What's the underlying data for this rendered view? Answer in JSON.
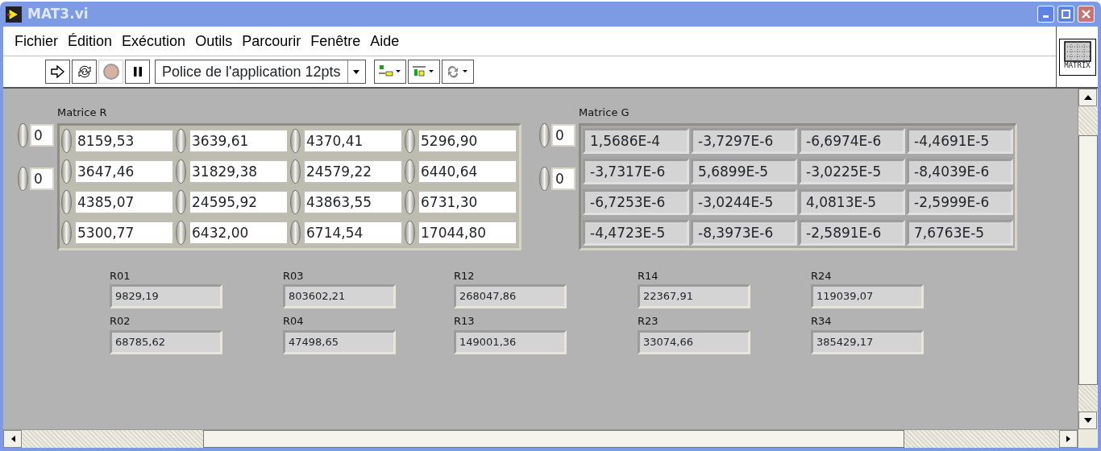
{
  "window": {
    "title": "MAT3.vi"
  },
  "menu": [
    {
      "label": "Fichier"
    },
    {
      "label": "Édition"
    },
    {
      "label": "Exécution"
    },
    {
      "label": "Outils"
    },
    {
      "label": "Parcourir"
    },
    {
      "label": "Fenêtre"
    },
    {
      "label": "Aide"
    }
  ],
  "toolbar": {
    "font_selector": "Police de l'application 12pts"
  },
  "vi_icon": {
    "label": "MATRIX"
  },
  "matrices": [
    {
      "label": "Matrice R",
      "kind": "control",
      "indices": [
        "0",
        "0"
      ],
      "rows": [
        [
          "8159,53",
          "3639,61",
          "4370,41",
          "5296,90"
        ],
        [
          "3647,46",
          "31829,38",
          "24579,22",
          "6440,64"
        ],
        [
          "4385,07",
          "24595,92",
          "43863,55",
          "6731,30"
        ],
        [
          "5300,77",
          "6432,00",
          "6714,54",
          "17044,80"
        ]
      ]
    },
    {
      "label": "Matrice G",
      "kind": "indicator",
      "indices": [
        "0",
        "0"
      ],
      "rows": [
        [
          "1,5686E-4",
          "-3,7297E-6",
          "-6,6974E-6",
          "-4,4691E-5"
        ],
        [
          "-3,7317E-6",
          "5,6899E-5",
          "-3,0225E-5",
          "-8,4039E-6"
        ],
        [
          "-6,7253E-6",
          "-3,0244E-5",
          "4,0813E-5",
          "-2,5999E-6"
        ],
        [
          "-4,4723E-5",
          "-8,3973E-6",
          "-2,5891E-6",
          "7,6763E-5"
        ]
      ]
    }
  ],
  "indicators": [
    {
      "label": "R01",
      "value": "9829,19"
    },
    {
      "label": "R03",
      "value": "803602,21"
    },
    {
      "label": "R12",
      "value": "268047,86"
    },
    {
      "label": "R14",
      "value": "22367,91"
    },
    {
      "label": "R24",
      "value": "119039,07"
    },
    {
      "label": "R02",
      "value": "68785,62"
    },
    {
      "label": "R04",
      "value": "47498,65"
    },
    {
      "label": "R13",
      "value": "149001,36"
    },
    {
      "label": "R23",
      "value": "33074,66"
    },
    {
      "label": "R34",
      "value": "385429,17"
    }
  ]
}
